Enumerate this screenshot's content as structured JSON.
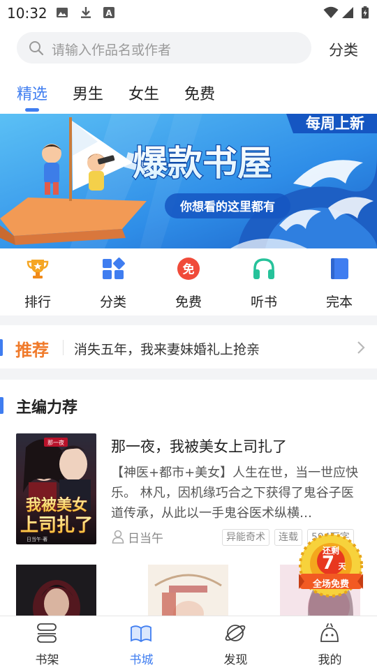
{
  "status_bar": {
    "time": "10:32"
  },
  "search": {
    "placeholder": "请输入作品名或作者",
    "category_label": "分类"
  },
  "tabs": [
    {
      "label": "精选",
      "active": true
    },
    {
      "label": "男生",
      "active": false
    },
    {
      "label": "女生",
      "active": false
    },
    {
      "label": "免费",
      "active": false
    }
  ],
  "banner": {
    "corner_text": "每周上新",
    "title": "爆款书屋",
    "subtitle": "你想看的这里都有",
    "page_count": 2,
    "current_page": 1
  },
  "quick_icons": [
    {
      "label": "排行",
      "icon": "trophy-icon",
      "color": "#f5a623"
    },
    {
      "label": "分类",
      "icon": "grid-icon",
      "color": "#3f7df0"
    },
    {
      "label": "免费",
      "icon": "free-icon",
      "color": "#f04b3a",
      "glyph": "免"
    },
    {
      "label": "听书",
      "icon": "headphones-icon",
      "color": "#26c29a"
    },
    {
      "label": "完本",
      "icon": "book-icon",
      "color": "#3f7df0"
    }
  ],
  "recommend": {
    "tag": "推荐",
    "text": "消失五年，我来妻妹婚礼上抢亲"
  },
  "section": {
    "title": "主编力荐"
  },
  "featured_book": {
    "title": "那一夜，我被美女上司扎了",
    "description": "【神医+都市+美女】人生在世，当一世应快乐。 林凡，因机缘巧合之下获得了鬼谷子医道传承，从此以一手鬼谷医术纵横…",
    "author": "日当午",
    "tags": [
      "异能奇术",
      "连载",
      "594万字"
    ],
    "cover_text": {
      "top": "那一夜",
      "line1": "我被美女",
      "line2": "上司扎了",
      "byline": "日当午·著"
    }
  },
  "promo_badge": {
    "top": "还剩",
    "number": "7",
    "unit": "天",
    "bottom": "全场免费"
  },
  "bottom_nav": [
    {
      "label": "书架",
      "icon": "bookshelf-icon",
      "active": false
    },
    {
      "label": "书城",
      "icon": "bookstore-icon",
      "active": true
    },
    {
      "label": "发现",
      "icon": "planet-icon",
      "active": false
    },
    {
      "label": "我的",
      "icon": "profile-icon",
      "active": false
    }
  ],
  "colors": {
    "accent": "#3f7df0",
    "recommend_tag": "#f07a2a"
  }
}
